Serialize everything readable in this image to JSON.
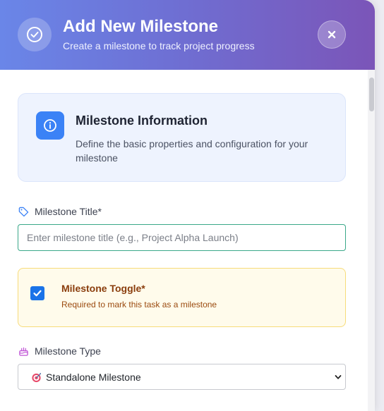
{
  "header": {
    "title": "Add New Milestone",
    "subtitle": "Create a milestone to track project progress",
    "close_icon": "close-icon",
    "status_icon": "check-circle-icon"
  },
  "info_card": {
    "icon": "info-icon",
    "title": "Milestone Information",
    "description": "Define the basic properties and configuration for your milestone"
  },
  "fields": {
    "title": {
      "icon": "tag-icon",
      "label": "Milestone Title*",
      "value": "",
      "placeholder": "Enter milestone title (e.g., Project Alpha Launch)"
    },
    "toggle": {
      "checked": true,
      "label": "Milestone Toggle*",
      "description": "Required to mark this task as a milestone"
    },
    "type": {
      "icon": "cake-icon",
      "label": "Milestone Type",
      "selected_icon": "target-icon",
      "selected": "Standalone Milestone"
    }
  },
  "colors": {
    "header_gradient_start": "#6a86e8",
    "header_gradient_end": "#7b55b8",
    "info_accent": "#3b82f6",
    "input_focus_border": "#3aa889",
    "toggle_background": "#fffbeb",
    "toggle_text": "#8a3d0c",
    "checkbox": "#1a73e8"
  }
}
